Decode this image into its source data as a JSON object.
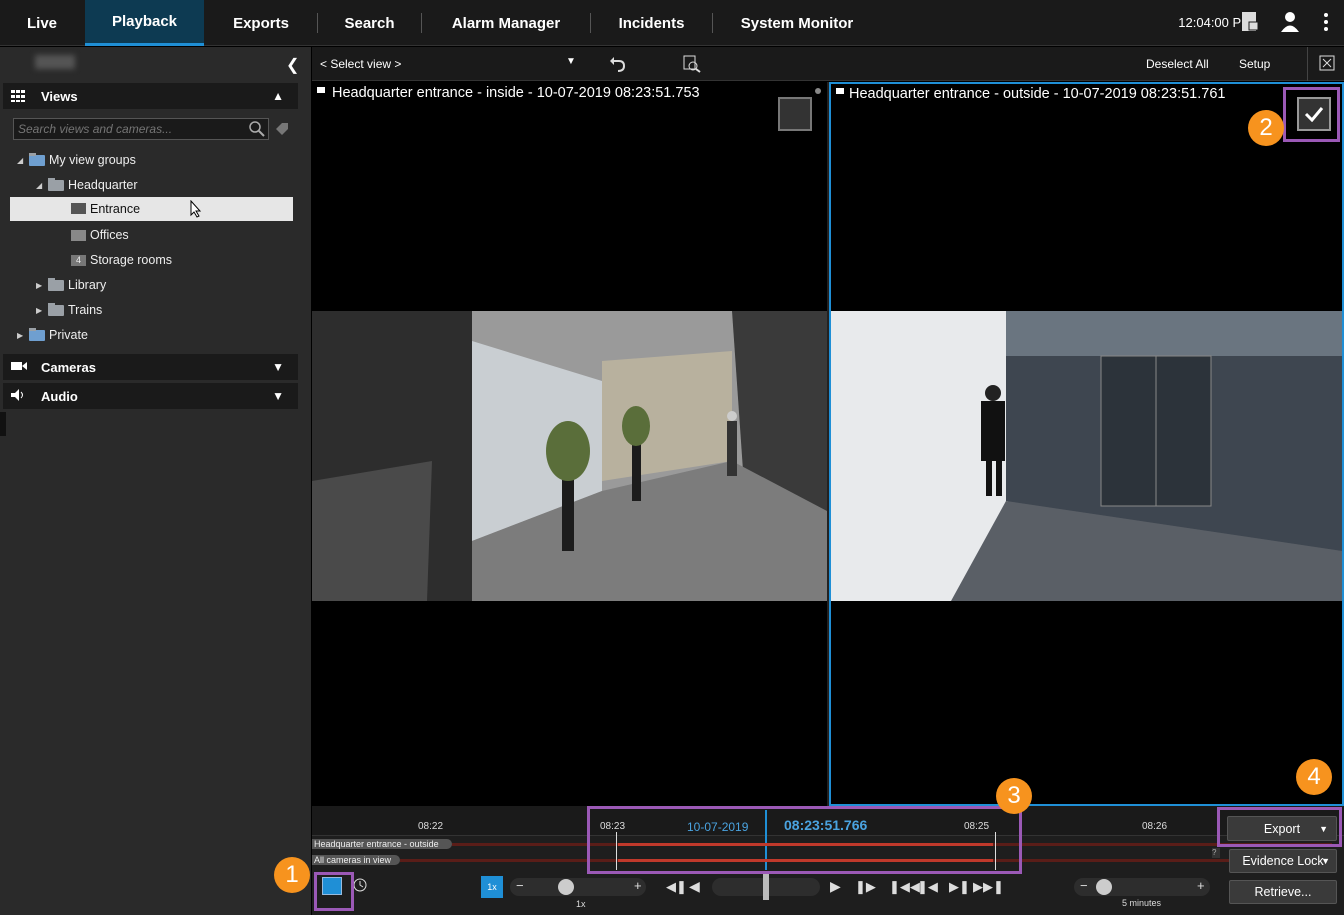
{
  "tabs": [
    "Live",
    "Playback",
    "Exports",
    "Search",
    "Alarm Manager",
    "Incidents",
    "System Monitor"
  ],
  "clock": "12:04:00 PM",
  "sidebar": {
    "views_header": "Views",
    "search_placeholder": "Search views and cameras...",
    "tree": [
      "My view groups",
      "Headquarter",
      "Entrance",
      "Offices",
      "Storage rooms",
      "Library",
      "Trains",
      "Private"
    ],
    "storage_badge": "4",
    "cameras_header": "Cameras",
    "audio_header": "Audio"
  },
  "toolbar": {
    "select_view": "< Select view >",
    "deselect_all": "Deselect All",
    "setup": "Setup"
  },
  "panes": {
    "left_title": "Headquarter entrance - inside - 10-07-2019 08:23:51.753",
    "right_title": "Headquarter entrance - outside - 10-07-2019 08:23:51.761"
  },
  "timeline": {
    "ticks": [
      "08:22",
      "08:23",
      "08:25",
      "08:26"
    ],
    "date": "10-07-2019",
    "current_time": "08:23:51.766",
    "track1": "Headquarter entrance - outside",
    "track2": "All cameras in view",
    "speed": "1x",
    "speed_label": "1x",
    "span_label": "5 minutes",
    "help": "?"
  },
  "buttons": {
    "export": "Export",
    "evidence_lock": "Evidence Lock",
    "retrieve": "Retrieve..."
  },
  "badges": [
    "1",
    "2",
    "3",
    "4"
  ],
  "colors": {
    "accent": "#1f8fd6",
    "badge": "#f7931e",
    "highlight": "#9b59b6",
    "recording": "#c0392b"
  }
}
